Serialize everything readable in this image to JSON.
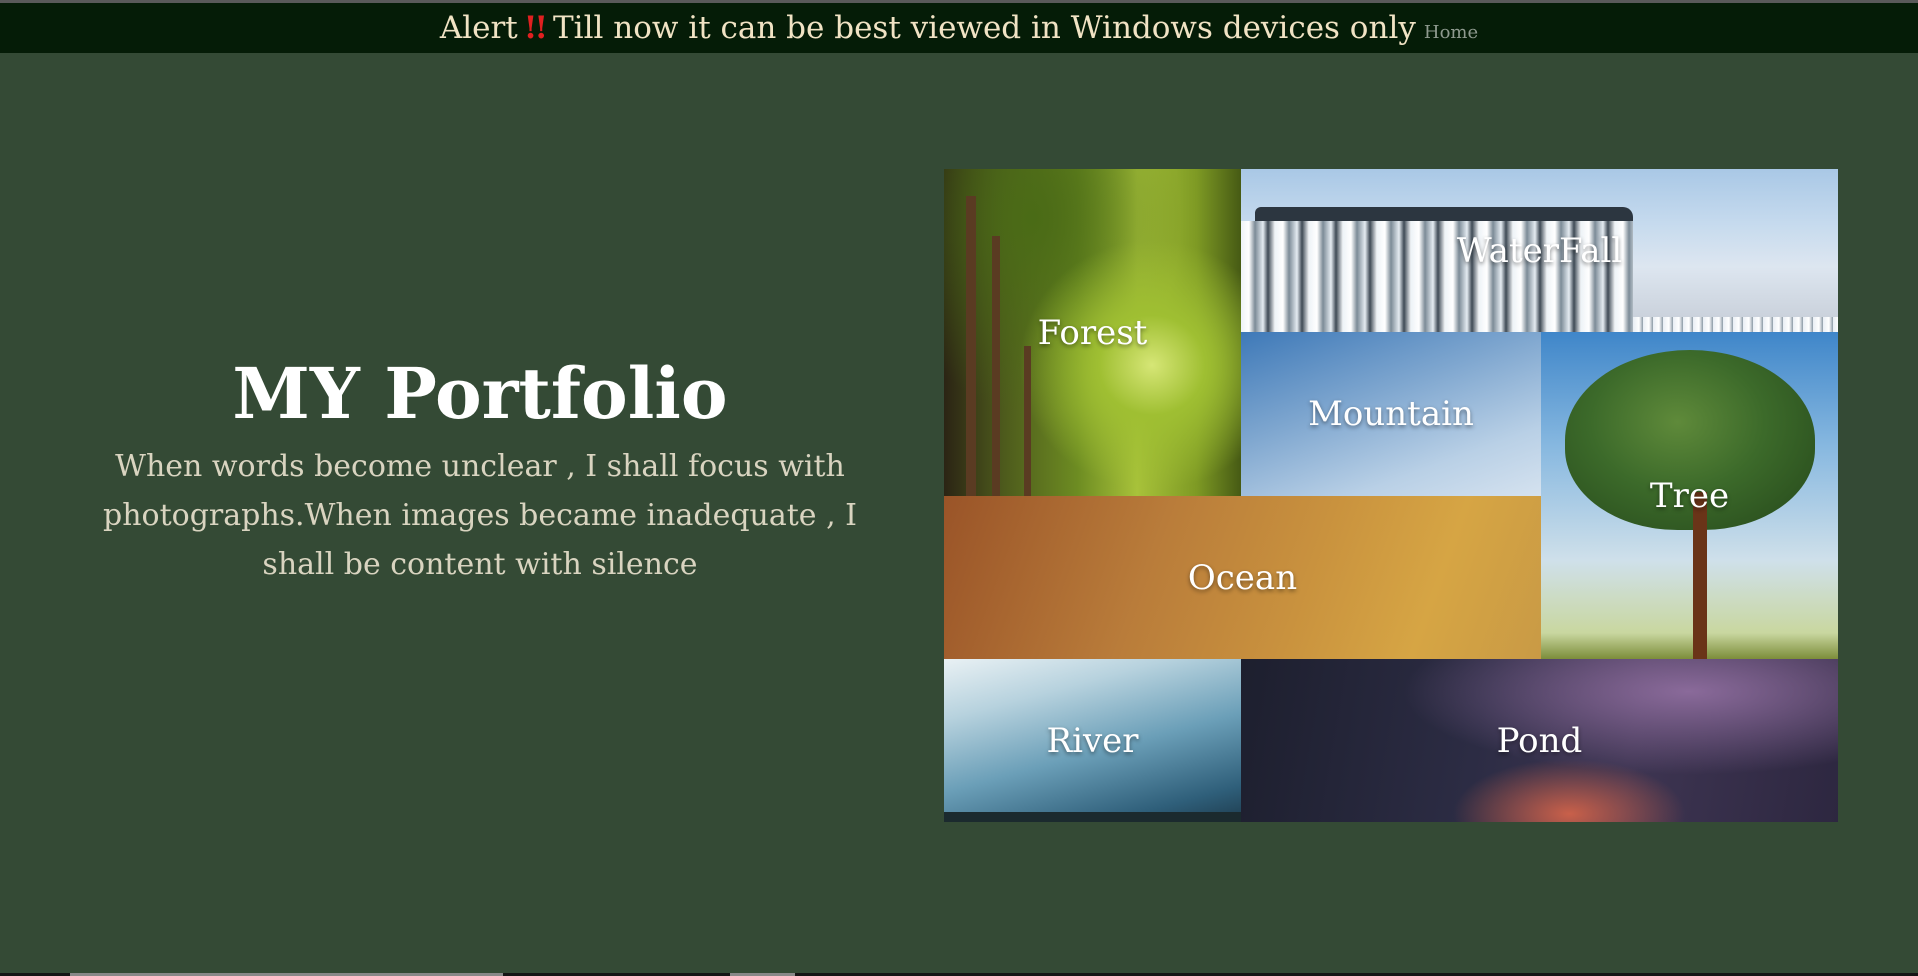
{
  "alert": {
    "prefix": "Alert",
    "icon": "double-exclamation-icon",
    "icon_glyph": "!!",
    "message": "Till now it can be best viewed in Windows devices only",
    "home_link": "Home"
  },
  "hero": {
    "title": "MY Portfolio",
    "quote": "When words become unclear , I shall focus with photographs.When images became inadequate , I shall be content with silence"
  },
  "gallery": {
    "forest": "Forest",
    "waterfall": "WaterFall",
    "mountain": "Mountain",
    "tree": "Tree",
    "ocean": "Ocean",
    "river": "River",
    "pond": "Pond"
  },
  "colors": {
    "background": "#344a35",
    "alert_bar": "#051c07",
    "alert_text": "#f1e3c4",
    "alert_icon": "#e02020"
  }
}
